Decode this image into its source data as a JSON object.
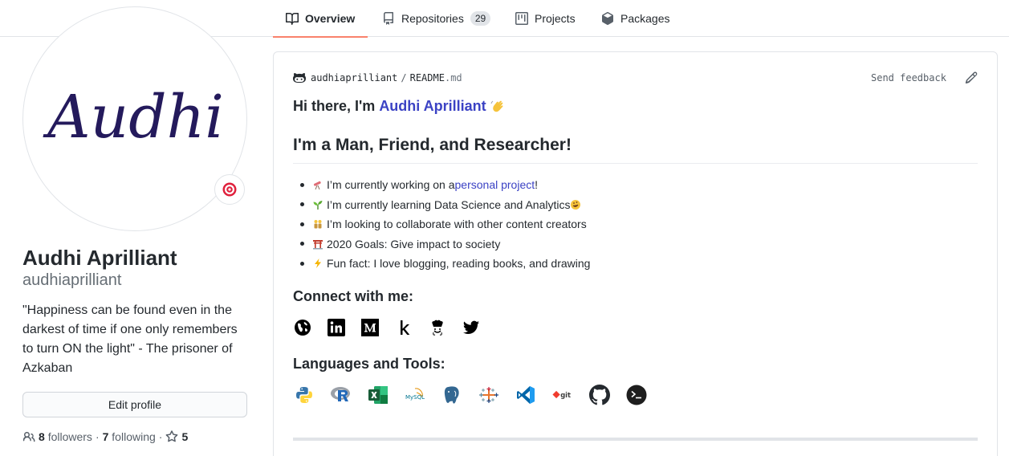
{
  "nav": {
    "tabs": [
      {
        "label": "Overview",
        "icon": "book-icon",
        "selected": true
      },
      {
        "label": "Repositories",
        "icon": "repo-icon",
        "count": "29"
      },
      {
        "label": "Projects",
        "icon": "project-icon"
      },
      {
        "label": "Packages",
        "icon": "package-icon"
      }
    ],
    "accent": "#f9826c"
  },
  "profile": {
    "avatar_text": "Audhi",
    "status_icon": "target-icon",
    "fullname": "Audhi Aprilliant",
    "username": "audhiaprilliant",
    "bio": "\"Happiness can be found even in the darkest of time if one only remembers to turn ON the light\" - The prisoner of Azkaban",
    "edit_label": "Edit profile",
    "followers_count": "8",
    "followers_label": "followers",
    "following_count": "7",
    "following_label": "following",
    "stars_count": "5"
  },
  "readme": {
    "owner": "audhiaprilliant",
    "slash": "/",
    "file": "README",
    "ext": ".md",
    "send_feedback": "Send feedback",
    "greeting_prefix": "Hi there, I'm",
    "greeting_name": "Audhi Aprilliant",
    "greeting_emoji": "wave-icon",
    "heading": "I'm a Man, Friend, and Researcher!",
    "facts": [
      {
        "emoji": "telescope-icon",
        "prefix": "I’m currently working on a ",
        "link": "personal project",
        "suffix": "!"
      },
      {
        "emoji": "seedling-icon",
        "text": "I’m currently learning Data Science and Analytics ",
        "trail_emoji": "rofl-icon"
      },
      {
        "emoji": "people-icon",
        "text": "I’m looking to collaborate with other content creators"
      },
      {
        "emoji": "torii-icon",
        "text": "2020 Goals: Give impact to society"
      },
      {
        "emoji": "zap-icon",
        "text": "Fun fact: I love blogging, reading books, and drawing"
      }
    ],
    "connect_heading": "Connect with me:",
    "socials": [
      "globe-icon",
      "linkedin-icon",
      "medium-icon",
      "kaggle-icon",
      "chef-icon",
      "twitter-icon"
    ],
    "tools_heading": "Languages and Tools:",
    "tools": [
      "python-icon",
      "r-icon",
      "excel-icon",
      "mysql-icon",
      "postgresql-icon",
      "tableau-icon",
      "vscode-icon",
      "git-icon",
      "github-icon",
      "terminal-icon"
    ],
    "link_color": "#3b42c4"
  }
}
